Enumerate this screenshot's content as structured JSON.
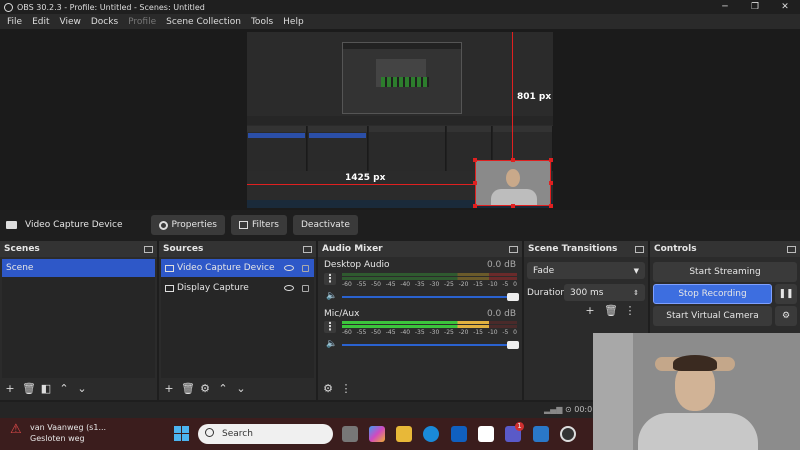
{
  "window": {
    "title": "OBS 30.2.3 - Profile: Untitled - Scenes: Untitled"
  },
  "menu": [
    "File",
    "Edit",
    "View",
    "Docks",
    "Profile",
    "Scene Collection",
    "Tools",
    "Help"
  ],
  "preview": {
    "width_label": "1425 px",
    "height_label": "801 px"
  },
  "source_toolbar": {
    "source_name": "Video Capture Device",
    "properties": "Properties",
    "filters": "Filters",
    "deactivate": "Deactivate"
  },
  "scenes": {
    "title": "Scenes",
    "items": [
      "Scene"
    ]
  },
  "sources": {
    "title": "Sources",
    "items": [
      {
        "name": "Video Capture Device",
        "icon": "camera-icon"
      },
      {
        "name": "Display Capture",
        "icon": "monitor-icon"
      }
    ]
  },
  "audio_mixer": {
    "title": "Audio Mixer",
    "channels": [
      {
        "name": "Desktop Audio",
        "db": "0.0 dB",
        "level": 0.0
      },
      {
        "name": "Mic/Aux",
        "db": "0.0 dB",
        "level": 0.85
      }
    ],
    "scale": [
      "-60",
      "-55",
      "-50",
      "-45",
      "-40",
      "-35",
      "-30",
      "-25",
      "-20",
      "-15",
      "-10",
      "-5",
      "0"
    ]
  },
  "transitions": {
    "title": "Scene Transitions",
    "selected": "Fade",
    "duration_label": "Duration",
    "duration_value": "300 ms"
  },
  "controls": {
    "title": "Controls",
    "start_streaming": "Start Streaming",
    "stop_recording": "Stop Recording",
    "start_virtual_camera": "Start Virtual Camera"
  },
  "statusbar": {
    "time": "00:0"
  },
  "taskbar": {
    "notification_title": "van Vaanweg (s1...",
    "notification_sub": "Gesloten weg",
    "search_placeholder": "Search",
    "badge_count": "1"
  },
  "colors": {
    "accent": "#2e58c8",
    "record_active": "#3d6ee0",
    "bounding_box": "#e02020"
  }
}
